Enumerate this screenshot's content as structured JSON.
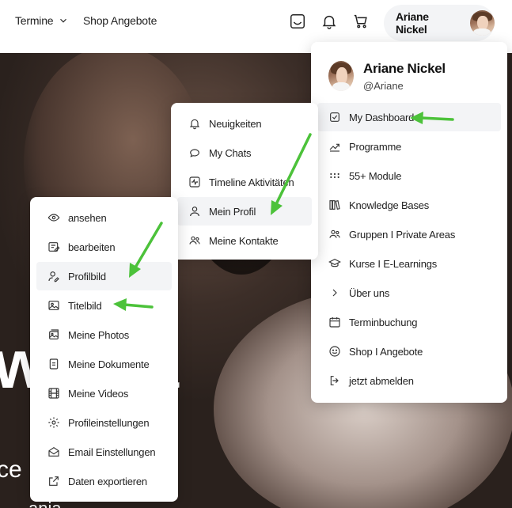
{
  "topbar": {
    "nav": [
      {
        "label": "Termine"
      },
      {
        "label": "Shop Angebote"
      }
    ],
    "user_name": "Ariane Nickel"
  },
  "hero": {
    "big_text": "w vita",
    "line2": "ce",
    "line3": "ania"
  },
  "profile_menu": {
    "name": "Ariane Nickel",
    "handle": "@Ariane",
    "items": [
      {
        "label": "My Dashboard",
        "icon": "check-square-icon"
      },
      {
        "label": "Programme",
        "icon": "trending-up-icon"
      },
      {
        "label": "55+ Module",
        "icon": "grid-dots-icon"
      },
      {
        "label": "Knowledge Bases",
        "icon": "books-icon"
      },
      {
        "label": "Gruppen I Private Areas",
        "icon": "users-icon"
      },
      {
        "label": "Kurse I E-Learnings",
        "icon": "graduation-cap-icon"
      },
      {
        "label": "Über uns",
        "icon": "chevron-right-icon"
      },
      {
        "label": "Terminbuchung",
        "icon": "calendar-icon"
      },
      {
        "label": "Shop I Angebote",
        "icon": "smile-icon"
      },
      {
        "label": "jetzt abmelden",
        "icon": "logout-icon"
      }
    ]
  },
  "profile_submenu": {
    "items": [
      {
        "label": "Neuigkeiten",
        "icon": "bell-icon"
      },
      {
        "label": "My Chats",
        "icon": "chat-icon"
      },
      {
        "label": "Timeline Aktivitäten",
        "icon": "activity-icon"
      },
      {
        "label": "Mein Profil",
        "icon": "user-icon"
      },
      {
        "label": "Meine Kontakte",
        "icon": "contacts-icon"
      }
    ]
  },
  "profile_actions": {
    "items": [
      {
        "label": "ansehen",
        "icon": "eye-icon"
      },
      {
        "label": "bearbeiten",
        "icon": "edit-icon"
      },
      {
        "label": "Profilbild",
        "icon": "user-edit-icon"
      },
      {
        "label": "Titelbild",
        "icon": "image-icon"
      },
      {
        "label": "Meine Photos",
        "icon": "photos-icon"
      },
      {
        "label": "Meine Dokumente",
        "icon": "document-icon"
      },
      {
        "label": "Meine Videos",
        "icon": "film-icon"
      },
      {
        "label": "Profileinstellungen",
        "icon": "gear-icon"
      },
      {
        "label": "Email Einstellungen",
        "icon": "envelope-open-icon"
      },
      {
        "label": "Daten exportieren",
        "icon": "export-icon"
      }
    ]
  },
  "colors": {
    "arrow": "#4cc23a",
    "active_bg": "#f3f4f6"
  }
}
